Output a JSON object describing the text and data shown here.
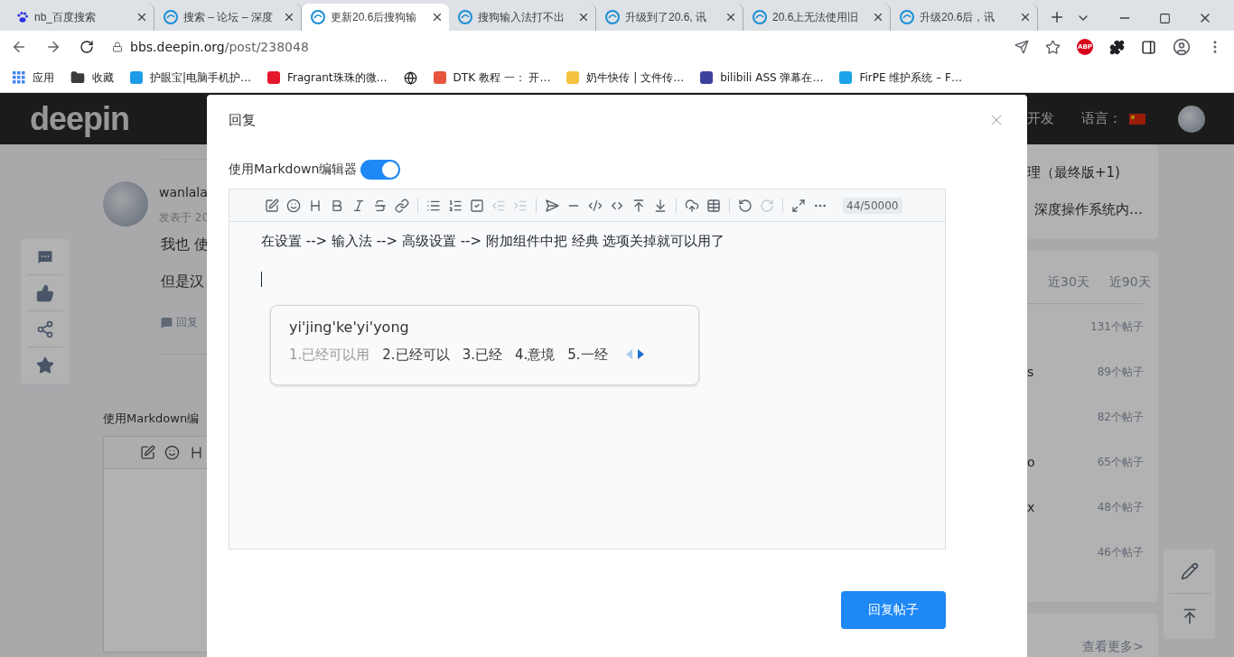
{
  "browser": {
    "tabs": [
      {
        "title": "nb_百度搜索",
        "kind": "paw",
        "selected": false
      },
      {
        "title": "搜索 – 论坛 – 深度",
        "kind": "swirl",
        "selected": false
      },
      {
        "title": "更新20.6后搜狗输",
        "kind": "swirl",
        "selected": true
      },
      {
        "title": "搜狗输入法打不出",
        "kind": "swirl",
        "selected": false
      },
      {
        "title": "升级到了20.6, 讯",
        "kind": "swirl",
        "selected": false
      },
      {
        "title": "20.6上无法使用旧",
        "kind": "swirl",
        "selected": false
      },
      {
        "title": "升级20.6后，讯",
        "kind": "swirl",
        "selected": false
      }
    ],
    "url_host": "bbs.deepin.org",
    "url_path": "/post/238048",
    "extension_badge": "ABP",
    "bookmarks": [
      {
        "kind": "apps",
        "label": "应用",
        "color": "#4285f4"
      },
      {
        "kind": "folder",
        "label": "收藏",
        "color": "#3c3c3c"
      },
      {
        "kind": "site",
        "label": "护眼宝|电脑手机护…",
        "color": "#1e9be8"
      },
      {
        "kind": "site",
        "label": "Fragrant珠珠的微…",
        "color": "#e6162d"
      },
      {
        "kind": "globe",
        "color": "#202124"
      },
      {
        "kind": "site",
        "label": "DTK 教程 一： 开…",
        "color": "#e8553e"
      },
      {
        "kind": "site",
        "label": "奶牛快传 | 文件传…",
        "color": "#f5c342"
      },
      {
        "kind": "site",
        "label": "bilibili ASS 弹幕在…",
        "color": "#3f3fa0"
      },
      {
        "kind": "site",
        "label": "FirPE 维护系统 – F…",
        "color": "#1aa3e8"
      }
    ]
  },
  "site_header": {
    "logo": "deepin",
    "nav": "开发",
    "language_label": "语言："
  },
  "post": {
    "author": "wanlala",
    "date": "发表于 20",
    "lines": [
      "我也 使",
      "但是汉"
    ],
    "reply": "回复",
    "editor_label": "使用Markdown编"
  },
  "sidebar_right": {
    "topics": [
      "理（最终版+1)",
      "深度操作系统内…"
    ],
    "ranking_tabs": [
      {
        "label": "近30天",
        "selected": false
      },
      {
        "label": "近90天",
        "selected": false
      }
    ],
    "ranking": [
      {
        "count": "131个帖子"
      },
      {
        "name": "s",
        "count": "89个帖子"
      },
      {
        "count": "82个帖子"
      },
      {
        "name": "o",
        "count": "65个帖子"
      },
      {
        "name": "x",
        "count": "48个帖子"
      },
      {
        "count": "46个帖子"
      }
    ],
    "more": "查看更多>"
  },
  "dialog": {
    "title": "回复",
    "markdown_toggle": {
      "label": "使用Markdown编辑器",
      "on": true
    },
    "toolbar_groups": [
      [
        {
          "disabled": false
        },
        {
          "disabled": false
        },
        {
          "disabled": false
        },
        {
          "disabled": false
        },
        {
          "disabled": false
        },
        {
          "disabled": false
        },
        {
          "disabled": false
        }
      ],
      [
        {
          "disabled": false
        },
        {
          "disabled": false
        },
        {
          "disabled": false
        },
        {
          "disabled": true
        },
        {
          "disabled": true
        }
      ],
      [
        {
          "disabled": false
        },
        {
          "disabled": false
        },
        {
          "disabled": false
        },
        {
          "disabled": false
        },
        {
          "disabled": false
        },
        {
          "disabled": false
        }
      ],
      [
        {
          "disabled": false
        },
        {
          "disabled": false
        }
      ],
      [
        {
          "disabled": false
        },
        {
          "disabled": true
        }
      ],
      [
        {
          "disabled": false
        },
        {
          "disabled": false
        }
      ]
    ],
    "counter": "44/50000",
    "content": "在设置 --> 输入法 --> 高级设置 --> 附加组件中把 经典 选项关掉就可以用了",
    "ime": {
      "pinyin": "yi'jing'ke'yi'yong",
      "candidates": [
        {
          "text": "1.已经可以用",
          "selected": true
        },
        {
          "text": "2.已经可以",
          "selected": false
        },
        {
          "text": "3.已经",
          "selected": false
        },
        {
          "text": "4.意境",
          "selected": false
        },
        {
          "text": "5.一经",
          "selected": false
        }
      ],
      "prev": {
        "disabled": true
      },
      "next": {
        "disabled": false
      }
    },
    "submit": "回复帖子"
  }
}
